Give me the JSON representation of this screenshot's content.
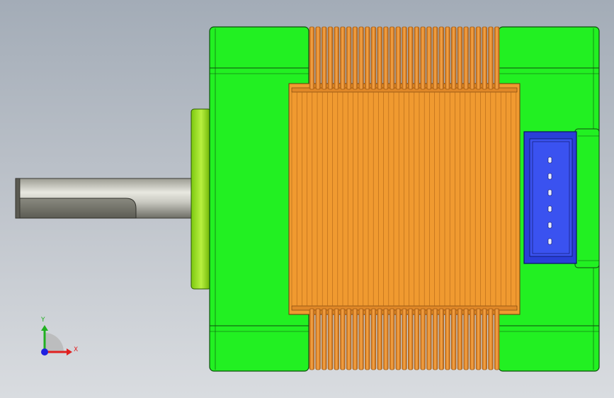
{
  "viewport": {
    "background_top": "#a3acb7",
    "background_bottom": "#d9dce0"
  },
  "model": {
    "housing_color": "#22f022",
    "winding_color": "#f09a30",
    "winding_dark": "#a05a10",
    "connector_color": "#2a3fd8",
    "connector_pins": 6,
    "shaft_color": "#c8c8c0",
    "winding_ribs": 31
  },
  "triad": {
    "x_label": "X",
    "y_label": "Y",
    "x_color": "#e02020",
    "y_color": "#20b020",
    "z_color": "#2020e0"
  }
}
